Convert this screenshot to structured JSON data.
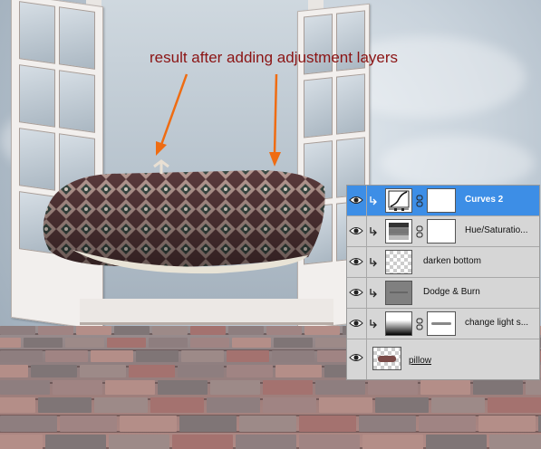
{
  "annotation": {
    "text": "result after adding adjustment layers",
    "color": "#8b1414",
    "arrow_color": "#ef6c12"
  },
  "layers_panel": {
    "selected_color": "#3d8ee6",
    "layers": [
      {
        "name": "Curves 2",
        "visible": true,
        "clipped": true,
        "selected": true,
        "thumb": "curves-adjustment-icon",
        "has_mask": true
      },
      {
        "name": "Hue/Saturatio...",
        "visible": true,
        "clipped": true,
        "selected": false,
        "thumb": "hue-saturation-adjustment-icon",
        "has_mask": true
      },
      {
        "name": "darken bottom",
        "visible": true,
        "clipped": true,
        "selected": false,
        "thumb": "transparent-thumbnail",
        "has_mask": false
      },
      {
        "name": "Dodge & Burn",
        "visible": true,
        "clipped": true,
        "selected": false,
        "thumb": "gray-fill-thumbnail",
        "has_mask": false
      },
      {
        "name": "change light s...",
        "visible": true,
        "clipped": true,
        "selected": false,
        "thumb": "gradient-fill-thumbnail",
        "has_mask": true
      },
      {
        "name": "pillow",
        "visible": true,
        "clipped": false,
        "selected": false,
        "thumb": "pillow-thumbnail",
        "has_mask": false
      }
    ]
  }
}
